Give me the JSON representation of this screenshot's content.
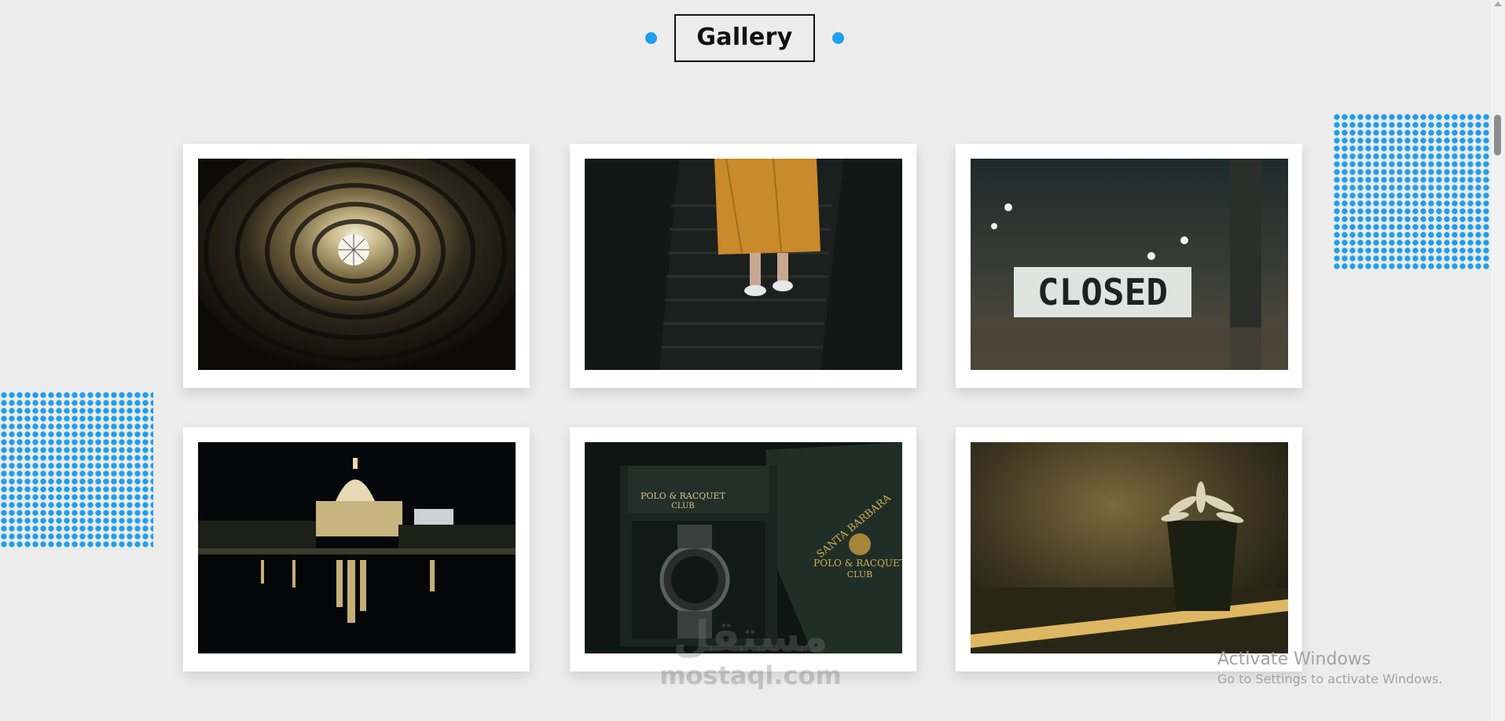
{
  "section": {
    "title": "Gallery"
  },
  "gallery": {
    "items": [
      {
        "subject": "spiral building ceiling"
      },
      {
        "subject": "person in orange coat on escalator"
      },
      {
        "subject": "CLOSED sign in window",
        "sign_text": "CLOSED"
      },
      {
        "subject": "capitol building at night reflection"
      },
      {
        "subject": "Polo & Racquet Club watch and bag",
        "box_text_1": "POLO & RACQUET",
        "box_text_2": "CLUB",
        "bag_text_1": "SANTA BARBARA",
        "bag_text_2": "POLO & RACQUET",
        "bag_text_3": "CLUB"
      },
      {
        "subject": "succulent plant in sunlight"
      }
    ]
  },
  "watermark": {
    "arabic": "مستقل",
    "latin": "mostaql.com"
  },
  "system_overlay": {
    "title": "Activate Windows",
    "subtitle": "Go to Settings to activate Windows."
  },
  "colors": {
    "accent": "#1f9fef",
    "background": "#ececec"
  },
  "icons": {
    "scroll_up": "scroll-up-arrow-icon"
  }
}
